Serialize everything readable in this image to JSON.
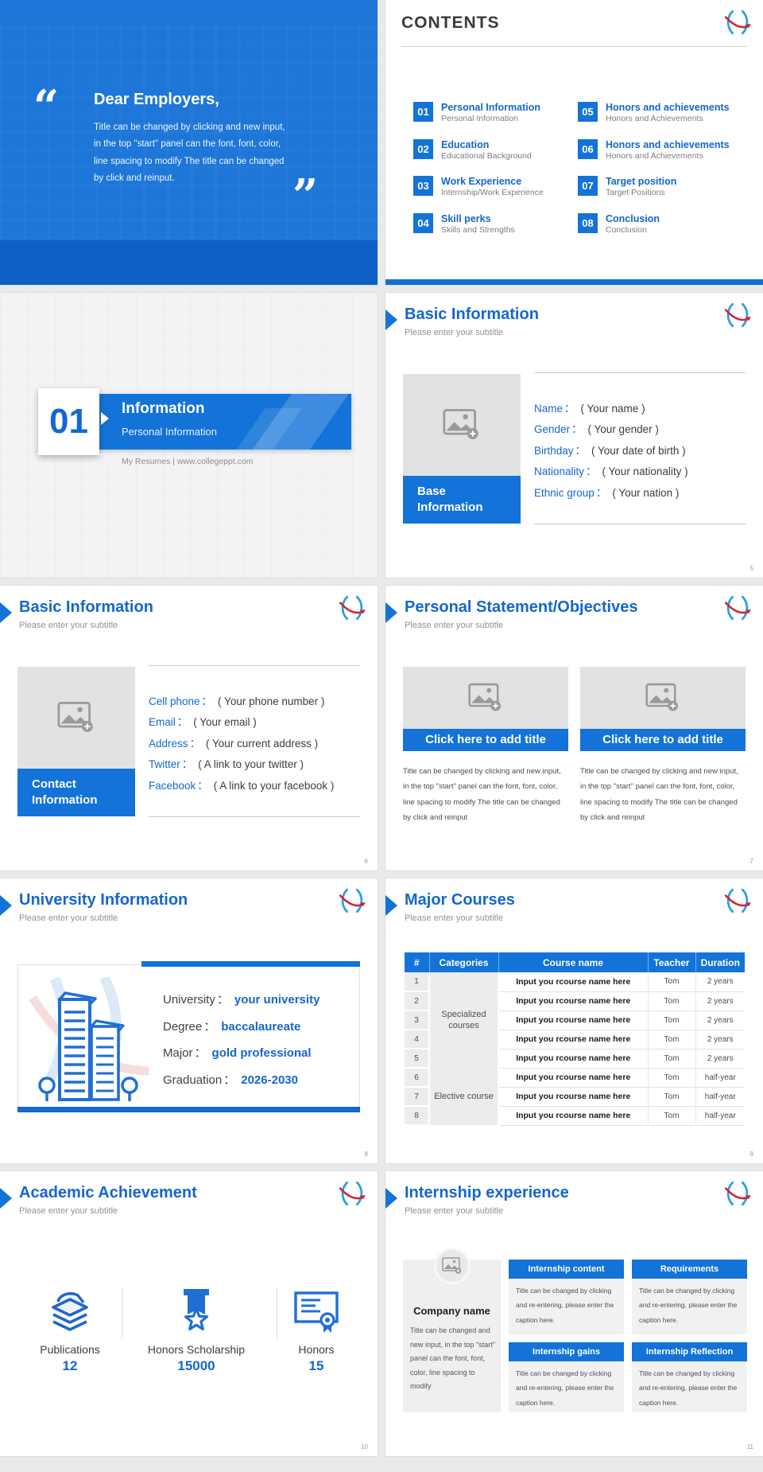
{
  "icons": {
    "logo": "x-swoosh-logo",
    "placeholder": "add-image-icon",
    "title_arrow": "right-arrow-icon",
    "publications": "books-icon",
    "scholarship": "medal-star-icon",
    "honors": "certificate-icon"
  },
  "colors": {
    "accent_blue": "#1373d8",
    "title_blue": "#1566cf",
    "cover_blue": "#1d76d8",
    "footer_blue": "#0f60c6",
    "logo_blue": "#2d9fe0",
    "logo_red": "#cf2533",
    "page_bg": "#e9eaec"
  },
  "common": {
    "subtitle": "Please enter your subtitle",
    "colon": "："
  },
  "cover": {
    "open_quote": "“",
    "close_quote": "”",
    "title": "Dear Employers,",
    "body": "Title can be changed by clicking and new input, in the top \"start\" panel can the font, font, color, line spacing to modify The title can be changed by click and reinput."
  },
  "contents": {
    "title": "CONTENTS",
    "items": [
      {
        "num": "01",
        "title": "Personal Information",
        "sub": "Personal Information"
      },
      {
        "num": "02",
        "title": "Education",
        "sub": "Educational Background"
      },
      {
        "num": "03",
        "title": "Work Experience",
        "sub": "Internship/Work Experience"
      },
      {
        "num": "04",
        "title": "Skill perks",
        "sub": "Skills and Strengths"
      },
      {
        "num": "05",
        "title": "Honors and achievements",
        "sub": "Honors and Achievements"
      },
      {
        "num": "06",
        "title": "Honors and achievements",
        "sub": "Honors and Achievements"
      },
      {
        "num": "07",
        "title": "Target position",
        "sub": "Target Positions"
      },
      {
        "num": "08",
        "title": "Conclusion",
        "sub": "Conclusion"
      }
    ]
  },
  "section": {
    "number": "01",
    "title": "Information",
    "subtitle": "Personal Information",
    "footer": "My Resumes | www.collegeppt.com"
  },
  "basic": {
    "title": "Basic Information",
    "page": "5",
    "box_line1": "Base",
    "box_line2": "Information",
    "fields": [
      {
        "label": "Name",
        "value": "( Your name )"
      },
      {
        "label": "Gender",
        "value": "( Your gender )"
      },
      {
        "label": "Birthday",
        "value": "( Your date of birth )"
      },
      {
        "label": "Nationality",
        "value": "( Your nationality )"
      },
      {
        "label": "Ethnic group",
        "value": "( Your nation )"
      }
    ]
  },
  "contact": {
    "title": "Basic Information",
    "page": "6",
    "box_line1": "Contact",
    "box_line2": "Information",
    "fields": [
      {
        "label": "Cell phone",
        "value": "( Your phone number )"
      },
      {
        "label": "Email",
        "value": "( Your email )"
      },
      {
        "label": "Address",
        "value": "( Your current address )"
      },
      {
        "label": "Twitter",
        "value": "( A link to your twitter )"
      },
      {
        "label": "Facebook",
        "value": "( A link to your facebook )"
      }
    ]
  },
  "statement": {
    "title": "Personal Statement/Objectives",
    "page": "7",
    "cards": [
      {
        "button": "Click here to add title",
        "caption": "Title can be changed by clicking and new input, in the top \"start\" panel can the font, font, color, line spacing to modify The title can be changed by click and reinput"
      },
      {
        "button": "Click here to add title",
        "caption": "Title can be changed by clicking and new input, in the top \"start\" panel can the font, font, color, line spacing to modify The title can be changed by click and reinput"
      }
    ]
  },
  "university": {
    "title": "University Information",
    "page": "8",
    "fields": [
      {
        "label": "University",
        "value": "your university"
      },
      {
        "label": "Degree",
        "value": "baccalaureate"
      },
      {
        "label": "Major",
        "value": "gold professional"
      },
      {
        "label": "Graduation",
        "value": "2026-2030"
      }
    ]
  },
  "courses": {
    "title": "Major Courses",
    "page": "9",
    "headers": [
      "#",
      "Categories",
      "Course name",
      "Teacher",
      "Duration"
    ],
    "category1": "Specialized courses",
    "category2": "Elective course",
    "rows": [
      {
        "num": "1",
        "name": "Input you rcourse name here",
        "teacher": "Tom",
        "duration": "2 years"
      },
      {
        "num": "2",
        "name": "Input you rcourse name here",
        "teacher": "Tom",
        "duration": "2 years"
      },
      {
        "num": "3",
        "name": "Input you rcourse name here",
        "teacher": "Tom",
        "duration": "2 years"
      },
      {
        "num": "4",
        "name": "Input you rcourse name here",
        "teacher": "Tom",
        "duration": "2 years"
      },
      {
        "num": "5",
        "name": "Input you rcourse name here",
        "teacher": "Tom",
        "duration": "2 years"
      },
      {
        "num": "6",
        "name": "Input you rcourse name here",
        "teacher": "Tom",
        "duration": "half-year"
      },
      {
        "num": "7",
        "name": "Input you rcourse name here",
        "teacher": "Tom",
        "duration": "half-year"
      },
      {
        "num": "8",
        "name": "Input you rcourse name here",
        "teacher": "Tom",
        "duration": "half-year"
      }
    ]
  },
  "achievement": {
    "title": "Academic Achievement",
    "page": "10",
    "stats": [
      {
        "label": "Publications",
        "value": "12"
      },
      {
        "label": "Honors Scholarship",
        "value": "15000"
      },
      {
        "label": "Honors",
        "value": "15"
      }
    ]
  },
  "internship": {
    "title": "Internship experience",
    "page": "11",
    "company": "Company name",
    "company_caption": "Title can be changed and new input, in the top \"start\" panel can the font, font, color, line spacing to modify",
    "boxes": [
      {
        "header": "Internship content",
        "caption": "Title can be changed by clicking and re-entering, please enter the caption here."
      },
      {
        "header": "Requirements",
        "caption": "Title can be changed by clicking and re-entering, please enter the caption here."
      },
      {
        "header": "Internship gains",
        "caption": "Title can be changed by clicking and re-entering, please enter the caption here."
      },
      {
        "header": "Internship Reflection",
        "caption": "Title can be changed by clicking and re-entering, please enter the caption here."
      }
    ]
  }
}
